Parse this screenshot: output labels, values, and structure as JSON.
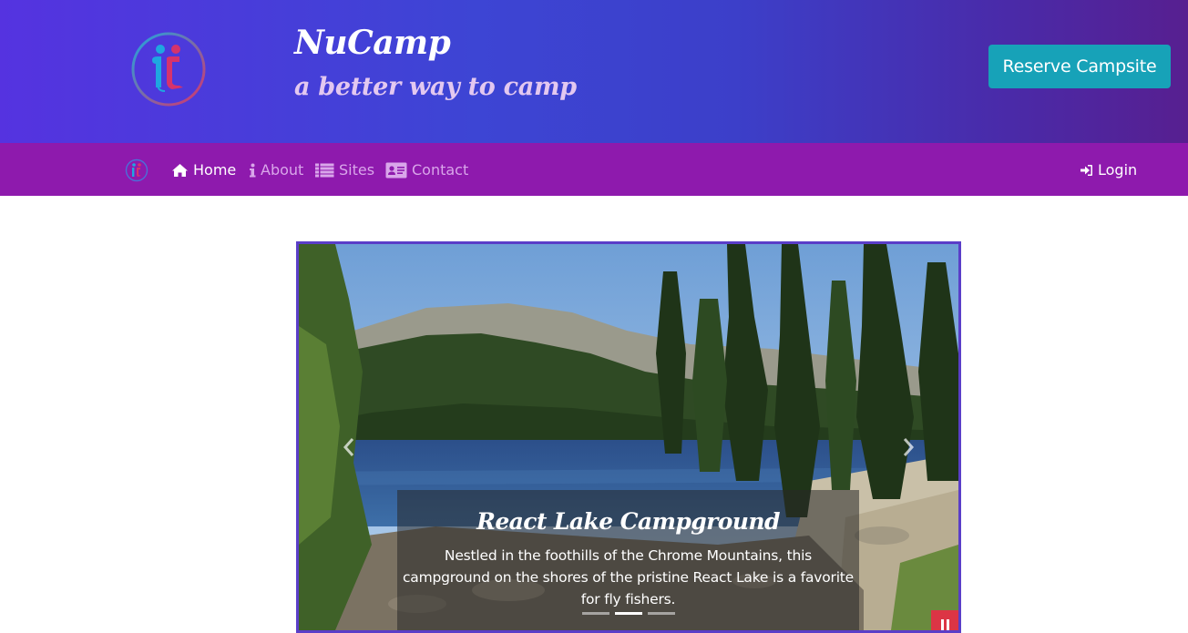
{
  "header": {
    "title": "NuCamp",
    "tagline": "a better way to camp",
    "reserve_label": "Reserve Campsite"
  },
  "nav": {
    "items": [
      {
        "label": "Home",
        "icon": "home-icon",
        "active": true
      },
      {
        "label": "About",
        "icon": "info-icon",
        "active": false
      },
      {
        "label": "Sites",
        "icon": "list-icon",
        "active": false
      },
      {
        "label": "Contact",
        "icon": "address-card-icon",
        "active": false
      }
    ],
    "login_label": "Login"
  },
  "carousel": {
    "caption_title": "React Lake Campground",
    "caption_text": "Nestled in the foothills of the Chrome Mountains, this campground on the shores of the pristine React Lake is a favorite for fly fishers.",
    "slide_count": 3,
    "active_slide": 2
  },
  "colors": {
    "header_gradient_start": "#5533e0",
    "header_gradient_end": "#571f90",
    "navbar": "#8e1aad",
    "reserve_button": "#17a2b8",
    "carousel_border": "#5a3ec8",
    "pause_button": "#dc3545"
  }
}
